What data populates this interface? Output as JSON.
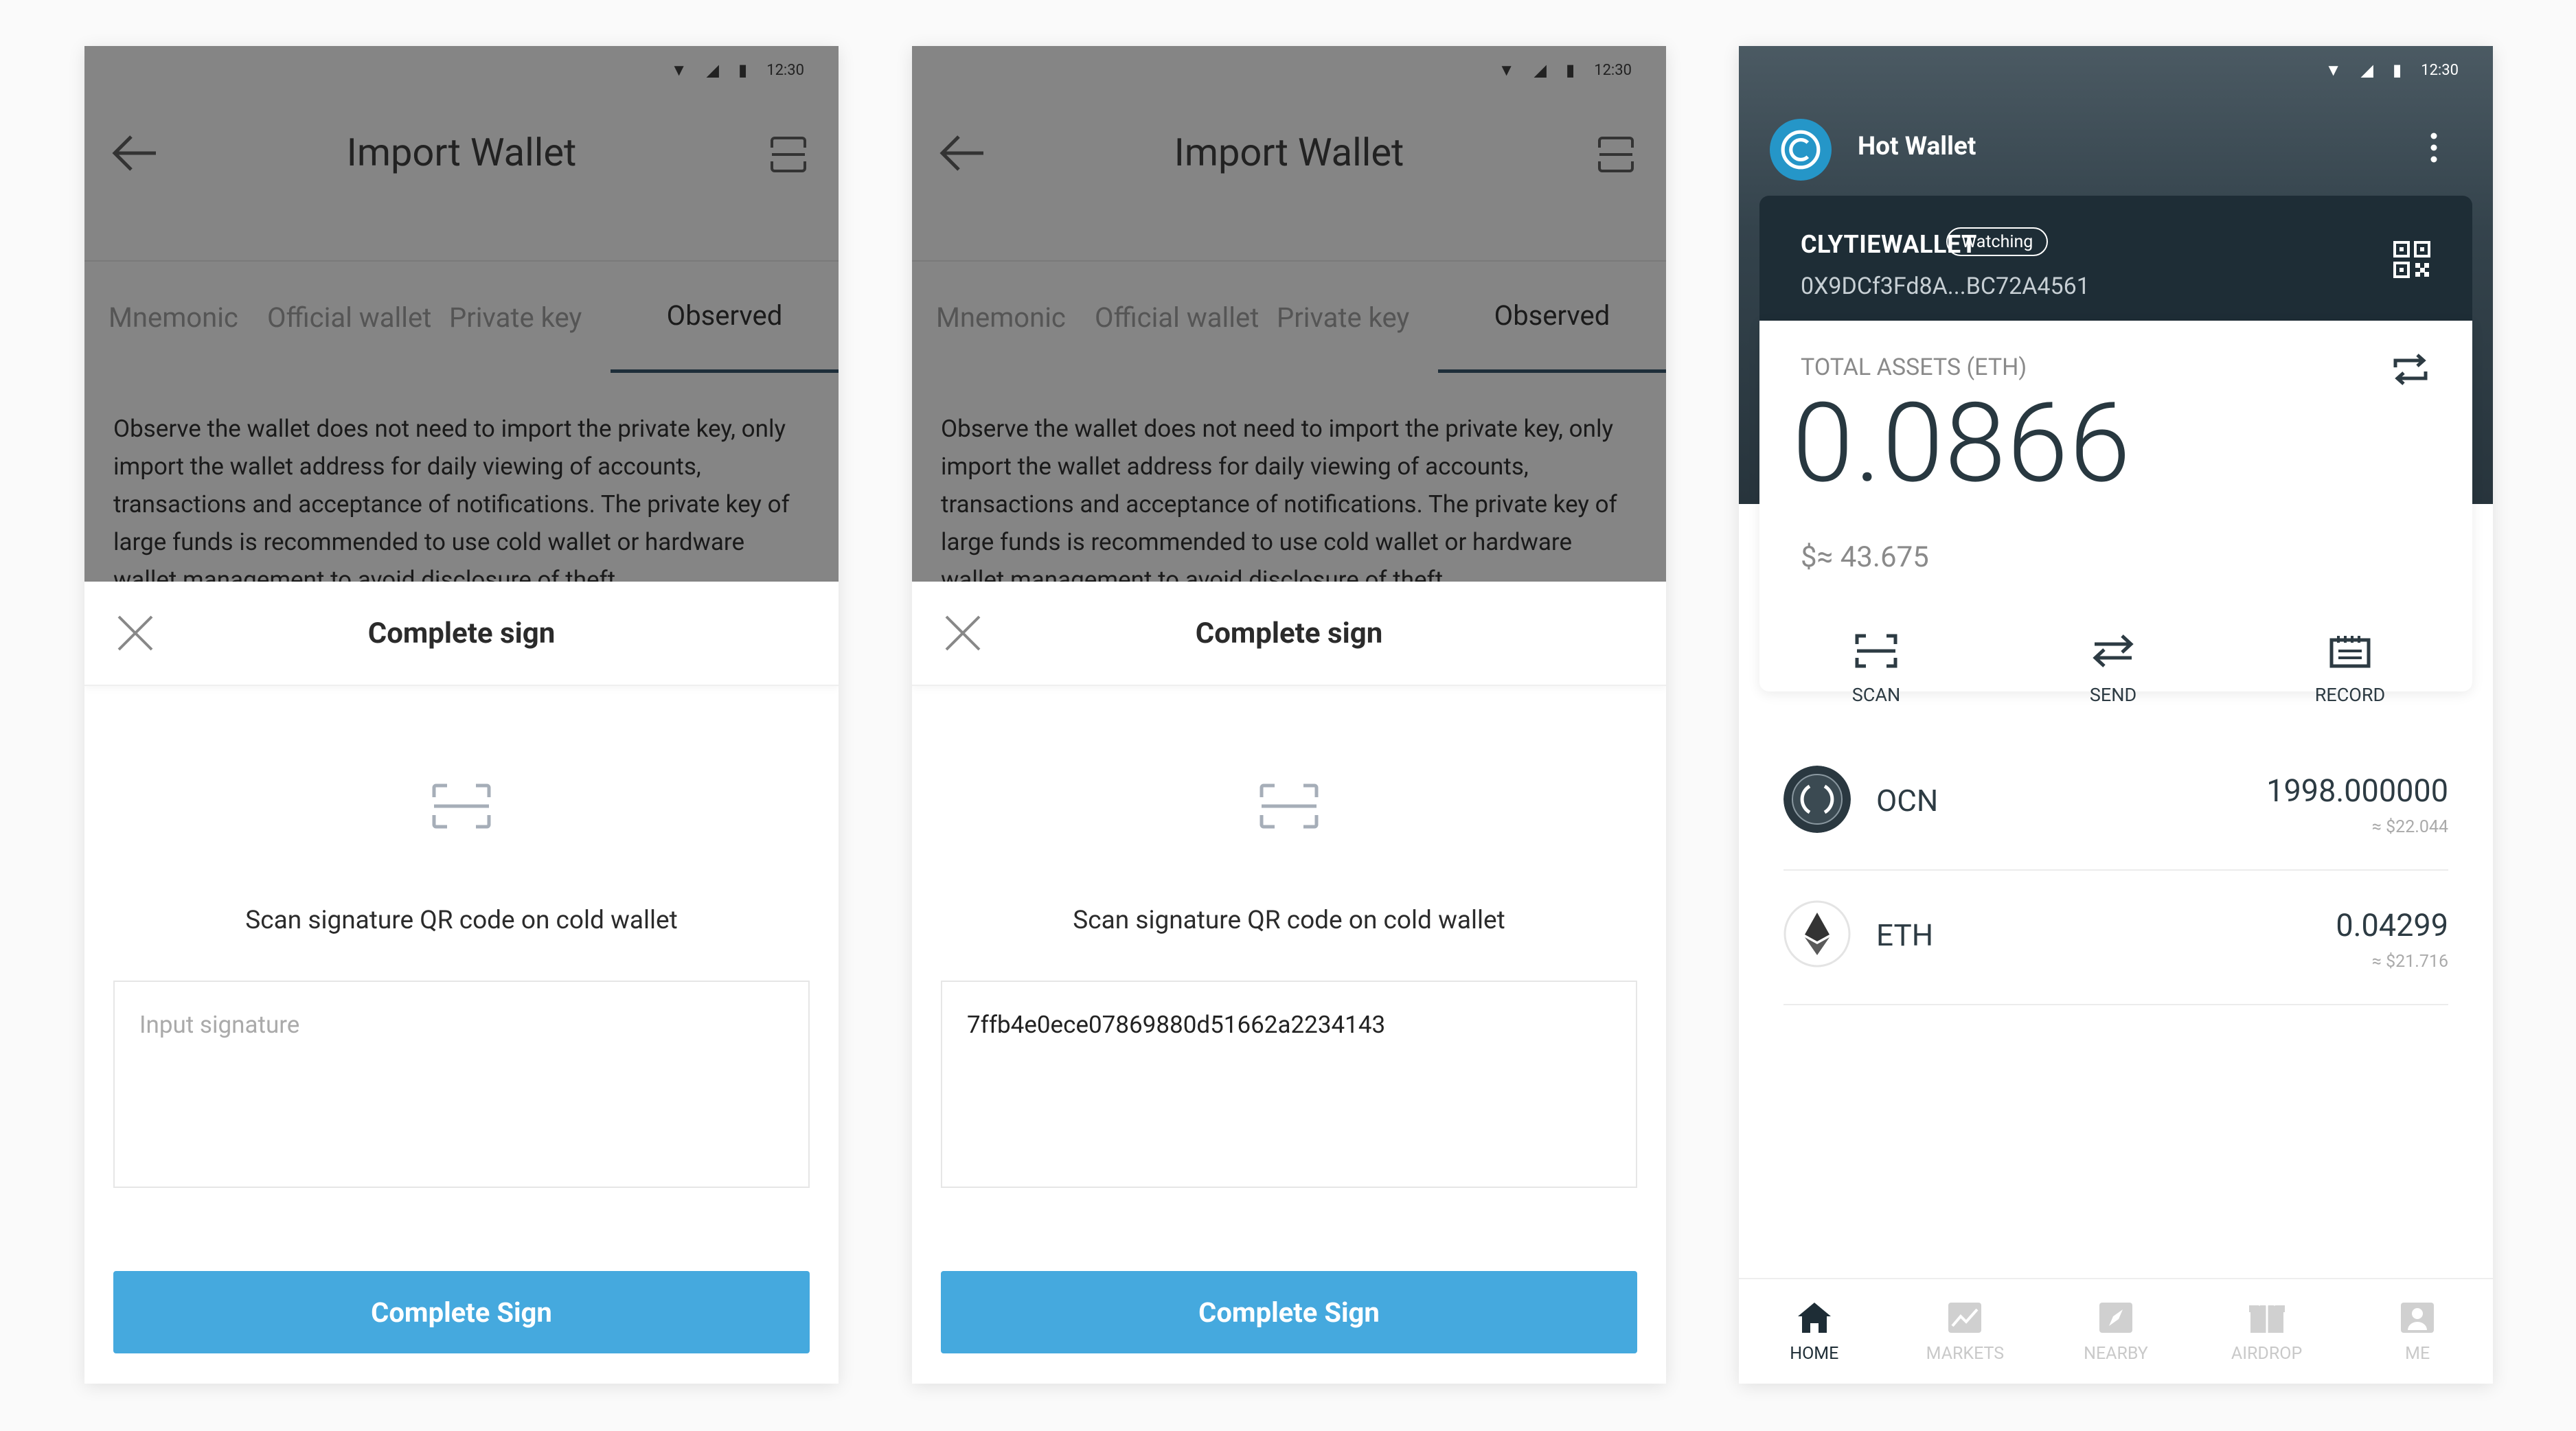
{
  "status_bar": {
    "time": "12:30"
  },
  "import_screens": [
    {
      "title": "Import Wallet",
      "tabs": [
        "Mnemonic",
        "Official wallet",
        "Private key",
        "Observed"
      ],
      "active_tab": "Observed",
      "description": "Observe the wallet does not need to import the private key, only import the wallet address for daily viewing of accounts, transactions and acceptance of notifications. The private key of large funds is recommended to use cold wallet or hardware wallet management to avoid disclosure of theft",
      "sheet_title": "Complete sign",
      "scan_hint": "Scan signature QR code on cold wallet",
      "input_placeholder": "Input signature",
      "input_value": "",
      "button_label": "Complete Sign"
    },
    {
      "title": "Import Wallet",
      "tabs": [
        "Mnemonic",
        "Official wallet",
        "Private key",
        "Observed"
      ],
      "active_tab": "Observed",
      "description": "Observe the wallet does not need to import the private key, only import the wallet address for daily viewing of accounts, transactions and acceptance of notifications. The private key of large funds is recommended to use cold wallet or hardware wallet management to avoid disclosure of theft",
      "sheet_title": "Complete sign",
      "scan_hint": "Scan signature QR code on cold wallet",
      "input_placeholder": "Input signature",
      "input_value": "7ffb4e0ece07869880d51662a2234143",
      "button_label": "Complete Sign"
    }
  ],
  "hot_wallet": {
    "title": "Hot Wallet",
    "wallet_name": "CLYTIEWALLET",
    "badge": "Watching",
    "address": "0X9DCf3Fd8A...BC72A4561",
    "total_label": "TOTAL ASSETS (ETH)",
    "total_value": "0.0866",
    "fiat_value": "$≈ 43.675",
    "actions": [
      "SCAN",
      "SEND",
      "RECORD"
    ],
    "tokens": [
      {
        "name": "OCN",
        "amount": "1998.000000",
        "fiat": "≈ $22.044"
      },
      {
        "name": "ETH",
        "amount": "0.04299",
        "fiat": "≈ $21.716"
      }
    ],
    "nav": [
      "HOME",
      "MARKETS",
      "NEARBY",
      "AIRDROP",
      "ME"
    ],
    "active_nav": "HOME",
    "colors": {
      "accent": "#45a9de",
      "dark": "#1e2d36",
      "logo": "#2596c8"
    }
  }
}
